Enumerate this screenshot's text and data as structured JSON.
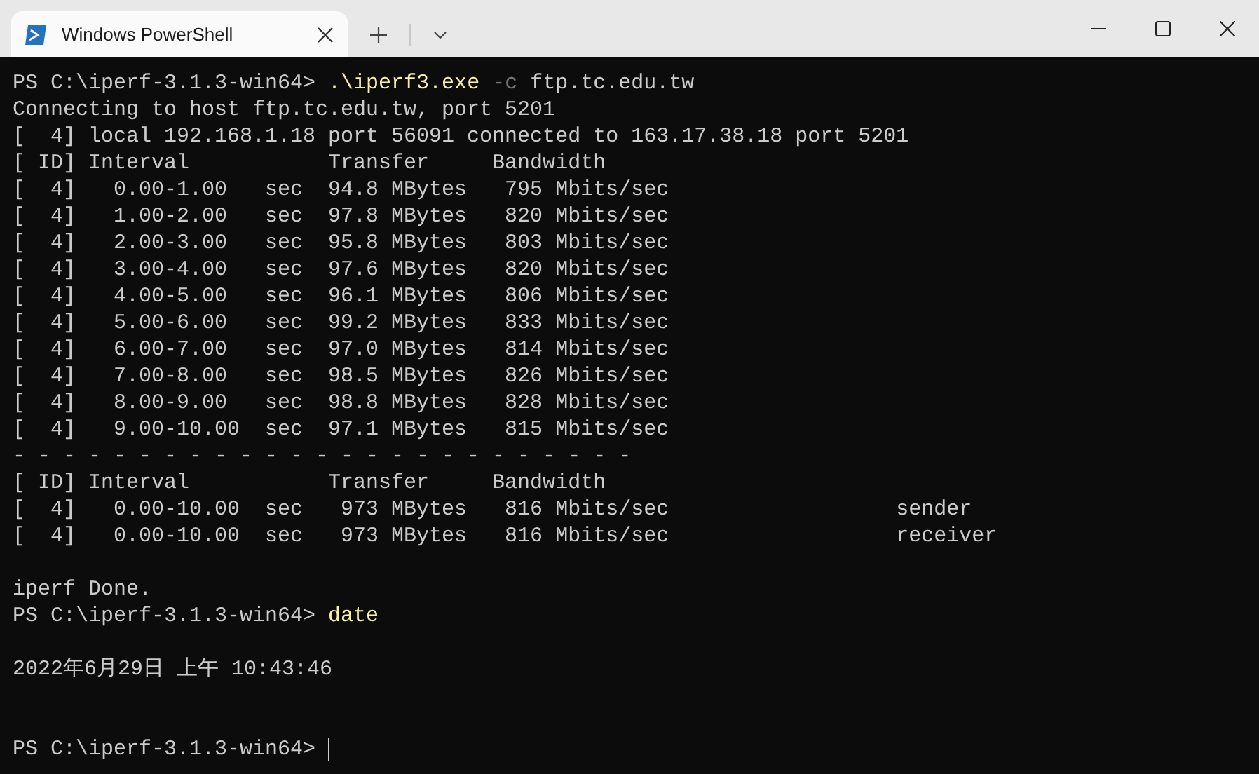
{
  "window": {
    "tab_title": "Windows PowerShell"
  },
  "lines": [
    {
      "kind": "prompt",
      "prompt": "PS C:\\iperf-3.1.3-win64>",
      "tokens": [
        {
          "kind": "command",
          "text": ".\\iperf3.exe"
        },
        {
          "kind": "parameter",
          "text": "-c"
        },
        {
          "kind": "argument",
          "text": "ftp.tc.edu.tw"
        }
      ]
    },
    {
      "kind": "output",
      "text": "Connecting to host ftp.tc.edu.tw, port 5201"
    },
    {
      "kind": "output",
      "text": "[  4] local 192.168.1.18 port 56091 connected to 163.17.38.18 port 5201"
    },
    {
      "kind": "output",
      "text": "[ ID] Interval           Transfer     Bandwidth"
    },
    {
      "kind": "output",
      "text": "[  4]   0.00-1.00   sec  94.8 MBytes   795 Mbits/sec"
    },
    {
      "kind": "output",
      "text": "[  4]   1.00-2.00   sec  97.8 MBytes   820 Mbits/sec"
    },
    {
      "kind": "output",
      "text": "[  4]   2.00-3.00   sec  95.8 MBytes   803 Mbits/sec"
    },
    {
      "kind": "output",
      "text": "[  4]   3.00-4.00   sec  97.6 MBytes   820 Mbits/sec"
    },
    {
      "kind": "output",
      "text": "[  4]   4.00-5.00   sec  96.1 MBytes   806 Mbits/sec"
    },
    {
      "kind": "output",
      "text": "[  4]   5.00-6.00   sec  99.2 MBytes   833 Mbits/sec"
    },
    {
      "kind": "output",
      "text": "[  4]   6.00-7.00   sec  97.0 MBytes   814 Mbits/sec"
    },
    {
      "kind": "output",
      "text": "[  4]   7.00-8.00   sec  98.5 MBytes   826 Mbits/sec"
    },
    {
      "kind": "output",
      "text": "[  4]   8.00-9.00   sec  98.8 MBytes   828 Mbits/sec"
    },
    {
      "kind": "output",
      "text": "[  4]   9.00-10.00  sec  97.1 MBytes   815 Mbits/sec"
    },
    {
      "kind": "output",
      "text": "- - - - - - - - - - - - - - - - - - - - - - - - -"
    },
    {
      "kind": "output",
      "text": "[ ID] Interval           Transfer     Bandwidth"
    },
    {
      "kind": "output",
      "text": "[  4]   0.00-10.00  sec   973 MBytes   816 Mbits/sec                  sender"
    },
    {
      "kind": "output",
      "text": "[  4]   0.00-10.00  sec   973 MBytes   816 Mbits/sec                  receiver"
    },
    {
      "kind": "blank"
    },
    {
      "kind": "output",
      "text": "iperf Done."
    },
    {
      "kind": "prompt",
      "prompt": "PS C:\\iperf-3.1.3-win64>",
      "tokens": [
        {
          "kind": "command",
          "text": "date"
        }
      ]
    },
    {
      "kind": "blank"
    },
    {
      "kind": "output",
      "text": "2022年6月29日 上午 10:43:46"
    },
    {
      "kind": "blank"
    },
    {
      "kind": "blank"
    },
    {
      "kind": "prompt",
      "prompt": "PS C:\\iperf-3.1.3-win64>",
      "cursor": true
    }
  ]
}
